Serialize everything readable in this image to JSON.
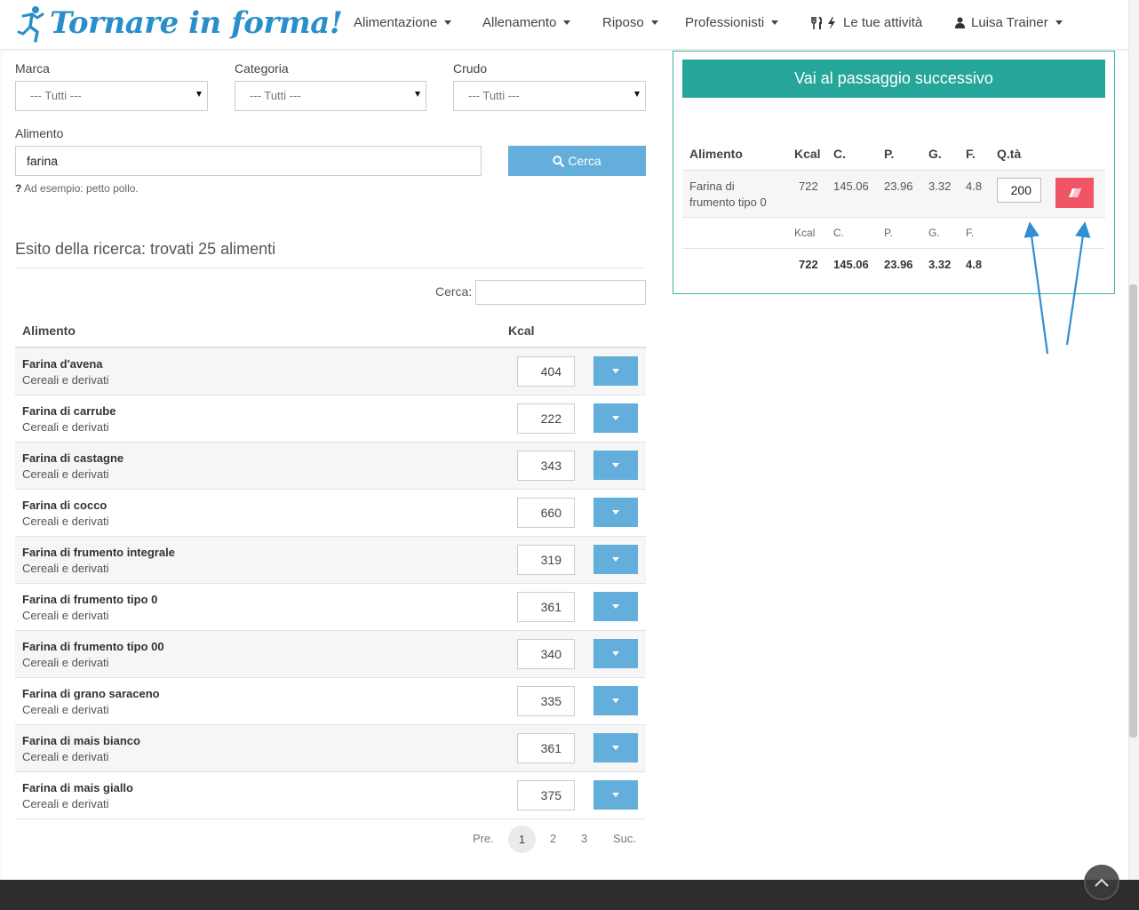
{
  "brand": {
    "name": "Tornare in forma!"
  },
  "nav": {
    "alimentazione": "Alimentazione",
    "allenamento": "Allenamento",
    "riposo": "Riposo",
    "professionisti": "Professionisti",
    "attivita": "Le tue attività",
    "user": "Luisa Trainer"
  },
  "filters": {
    "marca_label": "Marca",
    "marca_value": "--- Tutti ---",
    "categoria_label": "Categoria",
    "categoria_value": "--- Tutti ---",
    "crudo_label": "Crudo",
    "crudo_value": "--- Tutti ---",
    "alimento_label": "Alimento",
    "alimento_value": "farina",
    "search_button": "Cerca",
    "hint_mark": "?",
    "hint": "Ad esempio: petto pollo."
  },
  "results": {
    "title": "Esito della ricerca: trovati 25 alimenti",
    "cerca_label": "Cerca:",
    "col_alimento": "Alimento",
    "col_kcal": "Kcal",
    "rows": [
      {
        "name": "Farina d'avena",
        "category": "Cereali e derivati",
        "kcal": "404"
      },
      {
        "name": "Farina di carrube",
        "category": "Cereali e derivati",
        "kcal": "222"
      },
      {
        "name": "Farina di castagne",
        "category": "Cereali e derivati",
        "kcal": "343"
      },
      {
        "name": "Farina di cocco",
        "category": "Cereali e derivati",
        "kcal": "660"
      },
      {
        "name": "Farina di frumento integrale",
        "category": "Cereali e derivati",
        "kcal": "319"
      },
      {
        "name": "Farina di frumento tipo 0",
        "category": "Cereali e derivati",
        "kcal": "361"
      },
      {
        "name": "Farina di frumento tipo 00",
        "category": "Cereali e derivati",
        "kcal": "340"
      },
      {
        "name": "Farina di grano saraceno",
        "category": "Cereali e derivati",
        "kcal": "335"
      },
      {
        "name": "Farina di mais bianco",
        "category": "Cereali e derivati",
        "kcal": "361"
      },
      {
        "name": "Farina di mais giallo",
        "category": "Cereali e derivati",
        "kcal": "375"
      }
    ]
  },
  "pagination": {
    "prev": "Pre.",
    "pages": [
      "1",
      "2",
      "3"
    ],
    "next": "Suc.",
    "active": "1"
  },
  "selection": {
    "next_button": "Vai al passaggio successivo",
    "headers": {
      "alimento": "Alimento",
      "kcal": "Kcal",
      "c": "C.",
      "p": "P.",
      "g": "G.",
      "f": "F.",
      "qty": "Q.tà"
    },
    "item": {
      "name_line1": "Farina di",
      "name_line2": "frumento tipo 0",
      "kcal": "722",
      "c": "145.06",
      "p": "23.96",
      "g": "3.32",
      "f": "4.8",
      "qty": "200"
    },
    "sub_headers": {
      "kcal": "Kcal",
      "c": "C.",
      "p": "P.",
      "g": "G.",
      "f": "F."
    },
    "totals": {
      "kcal": "722",
      "c": "145.06",
      "p": "23.96",
      "g": "3.32",
      "f": "4.8"
    }
  },
  "colors": {
    "brand": "#2a8fc9",
    "primary_button": "#63aedb",
    "teal": "#26a69a",
    "danger": "#ef5565",
    "annotation_arrow": "#2f8fd0"
  },
  "icons": {
    "logo": "runner-icon",
    "restaurant": "cutlery-icon",
    "activity": "bolt-icon",
    "user": "user-icon",
    "search": "search-icon",
    "delete": "eraser-icon",
    "add": "caret-down-icon",
    "top": "chevron-up-icon"
  }
}
